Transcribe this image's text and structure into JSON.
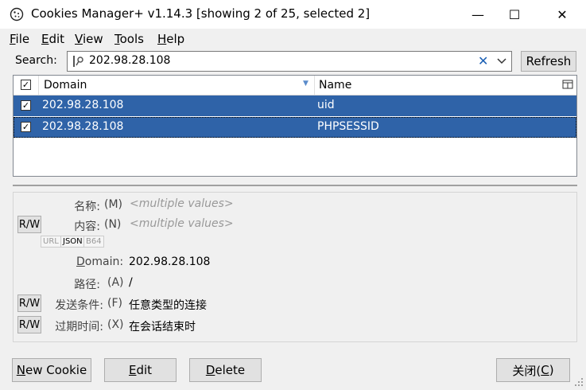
{
  "window": {
    "title": "Cookies Manager+ v1.14.3 [showing 2 of 25, selected 2]",
    "minimize_glyph": "—",
    "maximize_glyph": "☐",
    "close_glyph": "✕"
  },
  "menu": [
    {
      "key": "F",
      "rest": "ile"
    },
    {
      "key": "E",
      "rest": "dit"
    },
    {
      "key": "V",
      "rest": "iew"
    },
    {
      "key": "T",
      "rest": "ools"
    },
    {
      "key": "H",
      "rest": "elp"
    }
  ],
  "search": {
    "label": "Search:",
    "value": "202.98.28.108",
    "refresh_label": "Refresh"
  },
  "table": {
    "columns": [
      "Domain",
      "Name"
    ],
    "rows": [
      {
        "domain": "202.98.28.108",
        "name": "uid",
        "checked": true
      },
      {
        "domain": "202.98.28.108",
        "name": "PHPSESSID",
        "checked": true
      }
    ]
  },
  "details": {
    "name_label": "名称:",
    "name_key": "(M)",
    "name_value": "<multiple values>",
    "content_label": "内容:",
    "content_key": "(N)",
    "content_value": "<multiple values>",
    "format_tabs": [
      "URL",
      "JSON",
      "B64"
    ],
    "domain_label_hl": "D",
    "domain_label_rest": "omain:",
    "domain_value": "202.98.28.108",
    "path_label": "路径:",
    "path_key": "(A)",
    "path_value": "/",
    "send_label": "发送条件:",
    "send_key": "(F)",
    "send_value": "任意类型的连接",
    "expire_label": "过期时间:",
    "expire_key": "(X)",
    "expire_value": "在会话结束时",
    "rw_label": "R/W"
  },
  "buttons": {
    "new_key": "N",
    "new_rest": "ew Cookie",
    "edit_key": "E",
    "edit_rest": "dit",
    "delete_key": "D",
    "delete_rest": "elete",
    "close_label": "关闭(",
    "close_key": "C",
    "close_end": ")"
  },
  "colors": {
    "selection": "#2f63a8",
    "background": "#f0f0f0"
  }
}
